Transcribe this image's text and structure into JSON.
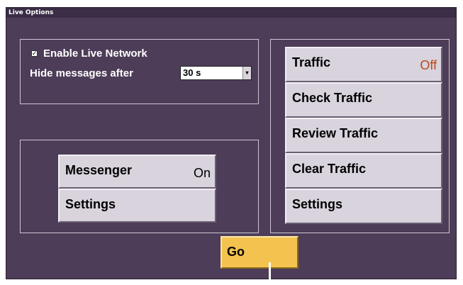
{
  "window": {
    "title": "Live Options"
  },
  "network": {
    "enable_label": "Enable Live Network",
    "enabled": true,
    "hide_label": "Hide messages after",
    "hide_value": "30 s"
  },
  "messenger": {
    "messenger_label": "Messenger",
    "messenger_state": "On",
    "settings_label": "Settings"
  },
  "traffic": {
    "traffic_label": "Traffic",
    "traffic_state": "Off",
    "check_label": "Check Traffic",
    "review_label": "Review Traffic",
    "clear_label": "Clear Traffic",
    "settings_label": "Settings",
    "off_color": "#b84a1a"
  },
  "go": {
    "label": "Go"
  }
}
